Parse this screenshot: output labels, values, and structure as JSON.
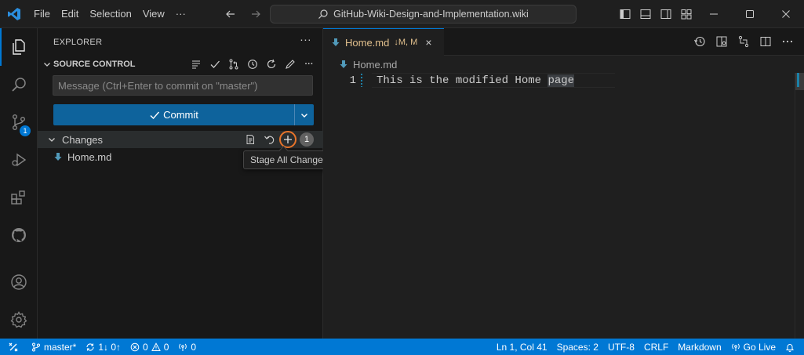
{
  "titlebar": {
    "menu": [
      "File",
      "Edit",
      "Selection",
      "View",
      "···"
    ],
    "command_center": "GitHub-Wiki-Design-and-Implementation.wiki"
  },
  "activity": {
    "scm_badge": "1"
  },
  "sidebar": {
    "header": "EXPLORER",
    "more": "···",
    "section_title": "SOURCE CONTROL",
    "section_more": "···",
    "message_placeholder": "Message (Ctrl+Enter to commit on \"master\")",
    "commit_label": "Commit",
    "changes_label": "Changes",
    "changes_count": "1",
    "file_name": "Home.md",
    "tooltip": "Stage All Changes"
  },
  "editor": {
    "tab_name": "Home.md",
    "tab_status": "↓M, M",
    "tab_close": "×",
    "breadcrumb": "Home.md",
    "line_number": "1",
    "code_prefix": "This is the modified Home ",
    "code_selected": "page"
  },
  "statusbar": {
    "branch": "master*",
    "sync": "1↓ 0↑",
    "errors": "0",
    "warnings": "0",
    "ports": "0",
    "position": "Ln 1, Col 41",
    "spaces": "Spaces: 2",
    "encoding": "UTF-8",
    "eol": "CRLF",
    "language": "Markdown",
    "golive": "Go Live"
  },
  "colors": {
    "accent": "#0078d4",
    "commit_button": "#0e639c",
    "modified": "#e2c08d",
    "highlight": "#e8742a"
  }
}
